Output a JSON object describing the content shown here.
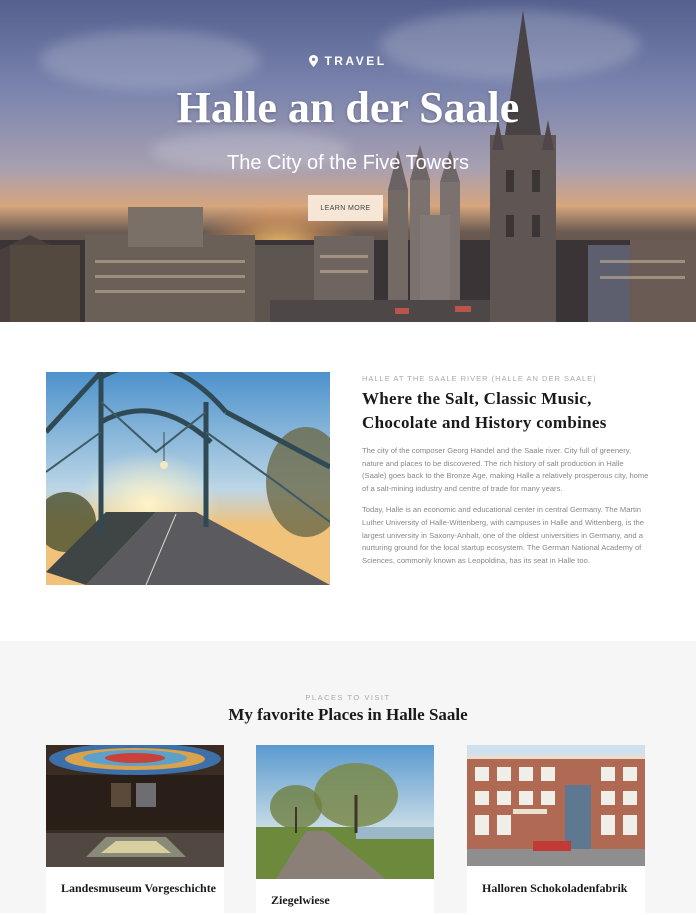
{
  "hero": {
    "eyebrow": "TRAVEL",
    "title": "Halle an der Saale",
    "tagline": "The City of the Five Towers",
    "button_label": "LEARN MORE"
  },
  "intro": {
    "kicker": "HALLE AT THE SAALE RIVER (HALLE AN DER SAALE)",
    "heading": "Where the Salt, Classic Music, Chocolate and History combines",
    "paragraphs": [
      "The city of the composer Georg Handel and the Saale river. City full of greenery, nature and places to be discovered. The rich history of salt production in Halle (Saale) goes back to the Bronze Age, making Halle a relatively prosperous city, home of a salt-mining industry and centre of trade for many years.",
      "Today, Halle is an economic and educational center in central Germany. The Martin Luther University of Halle-Wittenberg, with campuses in Halle and Wittenberg, is the largest university in Saxony-Anhalt, one of the oldest universities in Germany, and a nurturing ground for the local startup ecosystem. The German National Academy of Sciences, commonly known as Leopoldina, has its seat in Halle too."
    ]
  },
  "places": {
    "kicker": "PLACES TO VISIT",
    "heading": "My favorite Places in Halle Saale",
    "cards": [
      {
        "name": "Landesmuseum Vorgeschichte"
      },
      {
        "name": "Ziegelwiese"
      },
      {
        "name": "Halloren Schokoladenfabrik"
      }
    ]
  },
  "colors": {
    "button_bg": "#f6e6d6",
    "section_bg": "#f6f6f6",
    "heading": "#1a1a1a",
    "muted": "#888888"
  }
}
